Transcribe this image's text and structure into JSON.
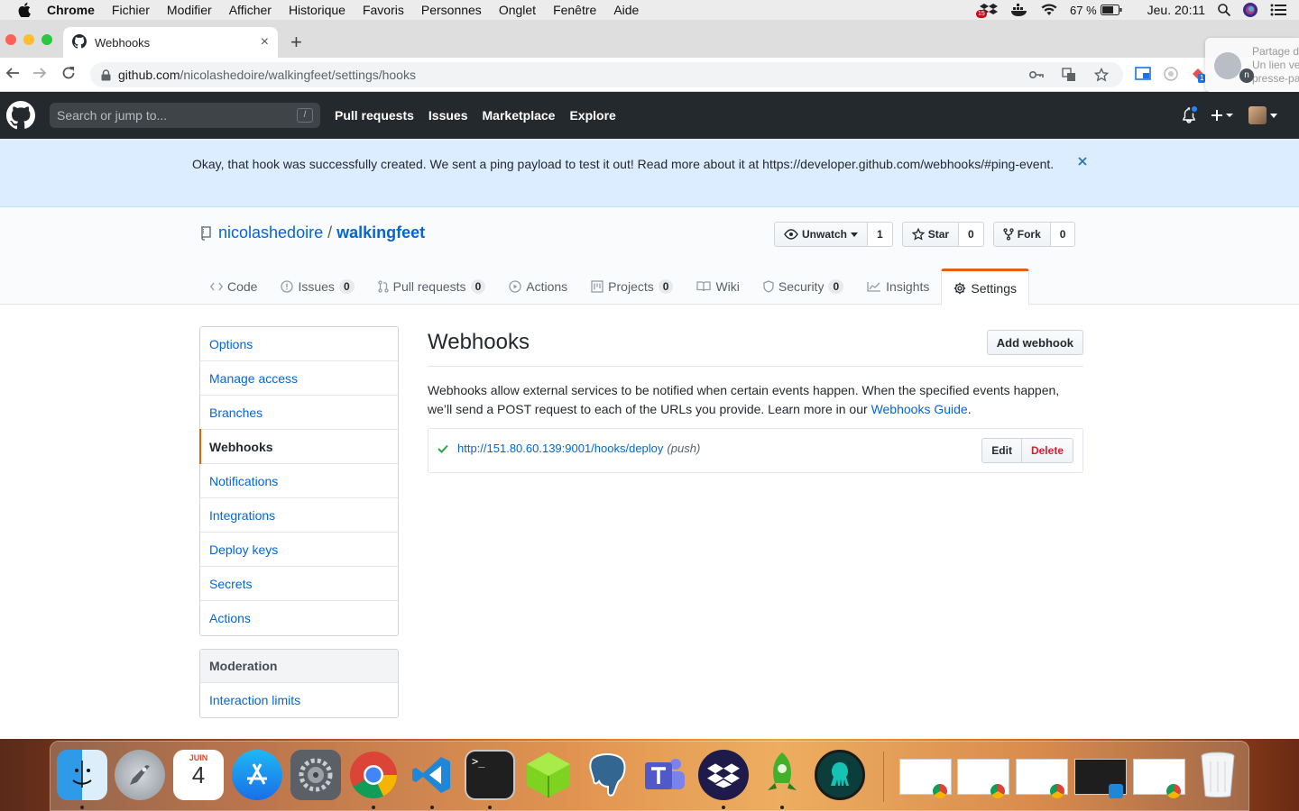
{
  "menubar": {
    "app": "Chrome",
    "items": [
      "Fichier",
      "Modifier",
      "Afficher",
      "Historique",
      "Favoris",
      "Personnes",
      "Onglet",
      "Fenêtre",
      "Aide"
    ],
    "battery": "67 %",
    "clock": "Jeu. 20:11",
    "badge_count": "15"
  },
  "browser": {
    "tab_title": "Webhooks",
    "url_host": "github.com",
    "url_path": "/nicolashedoire/walkingfeet/settings/hooks",
    "ext_badge": "1",
    "share_popup": {
      "title": "Partage d",
      "line1": "Un lien ve",
      "line2": "presse-pa",
      "avatar_letter": "n"
    }
  },
  "github": {
    "search_placeholder": "Search or jump to...",
    "search_shortcut": "/",
    "nav": [
      "Pull requests",
      "Issues",
      "Marketplace",
      "Explore"
    ]
  },
  "flash": {
    "message": "Okay, that hook was successfully created. We sent a ping payload to test it out! Read more about it at https://developer.github.com/webhooks/#ping-event."
  },
  "repo": {
    "owner": "nicolashedoire",
    "separator": "/",
    "name": "walkingfeet",
    "watch_label": "Unwatch",
    "watch_count": "1",
    "star_label": "Star",
    "star_count": "0",
    "fork_label": "Fork",
    "fork_count": "0",
    "tabs": [
      {
        "label": "Code"
      },
      {
        "label": "Issues",
        "count": "0"
      },
      {
        "label": "Pull requests",
        "count": "0"
      },
      {
        "label": "Actions"
      },
      {
        "label": "Projects",
        "count": "0"
      },
      {
        "label": "Wiki"
      },
      {
        "label": "Security",
        "count": "0"
      },
      {
        "label": "Insights"
      },
      {
        "label": "Settings"
      }
    ]
  },
  "sidebar": {
    "items": [
      "Options",
      "Manage access",
      "Branches",
      "Webhooks",
      "Notifications",
      "Integrations",
      "Deploy keys",
      "Secrets",
      "Actions"
    ],
    "moderation_heading": "Moderation",
    "moderation_items": [
      "Interaction limits"
    ]
  },
  "main": {
    "title": "Webhooks",
    "add_button": "Add webhook",
    "description": "Webhooks allow external services to be notified when certain events happen. When the specified events happen, we’ll send a POST request to each of the URLs you provide. Learn more in our ",
    "guide_link": "Webhooks Guide",
    "description_end": ".",
    "hook": {
      "url": "http://151.80.60.139:9001/hooks/deploy",
      "events": "(push)",
      "edit_label": "Edit",
      "delete_label": "Delete"
    }
  },
  "dock": {
    "calendar_month": "JUIN",
    "calendar_day": "4"
  }
}
